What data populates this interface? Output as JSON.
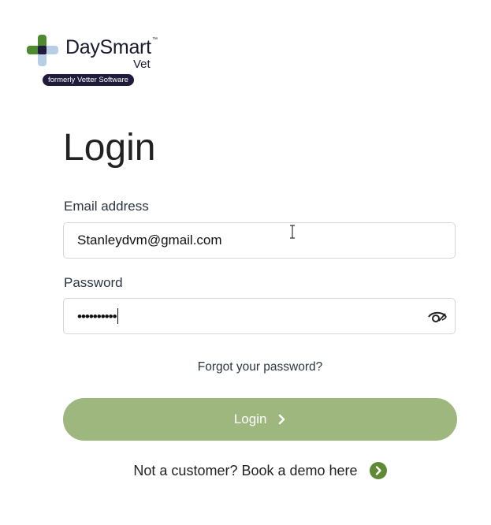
{
  "logo": {
    "wordmark": "DaySmart",
    "trademark": "™",
    "subbrand": "Vet",
    "badge": "formerly Vetter Software"
  },
  "form": {
    "title": "Login",
    "email_label": "Email address",
    "email_value": "Stanleydvm@gmail.com",
    "password_label": "Password",
    "password_mask": "••••••••••",
    "forgot_link": "Forgot your password?",
    "login_button": "Login",
    "demo_text": "Not a customer? Book a demo here"
  },
  "colors": {
    "primary_button": "#9db77f",
    "demo_icon": "#5f8a35",
    "badge_bg": "#1f1b3a"
  },
  "icons": {
    "logo": "daysmart-plus-logo",
    "password_toggle": "eye-slash-icon",
    "login_chevron": "chevron-right-icon",
    "demo_arrow": "chevron-right-circle-icon"
  }
}
